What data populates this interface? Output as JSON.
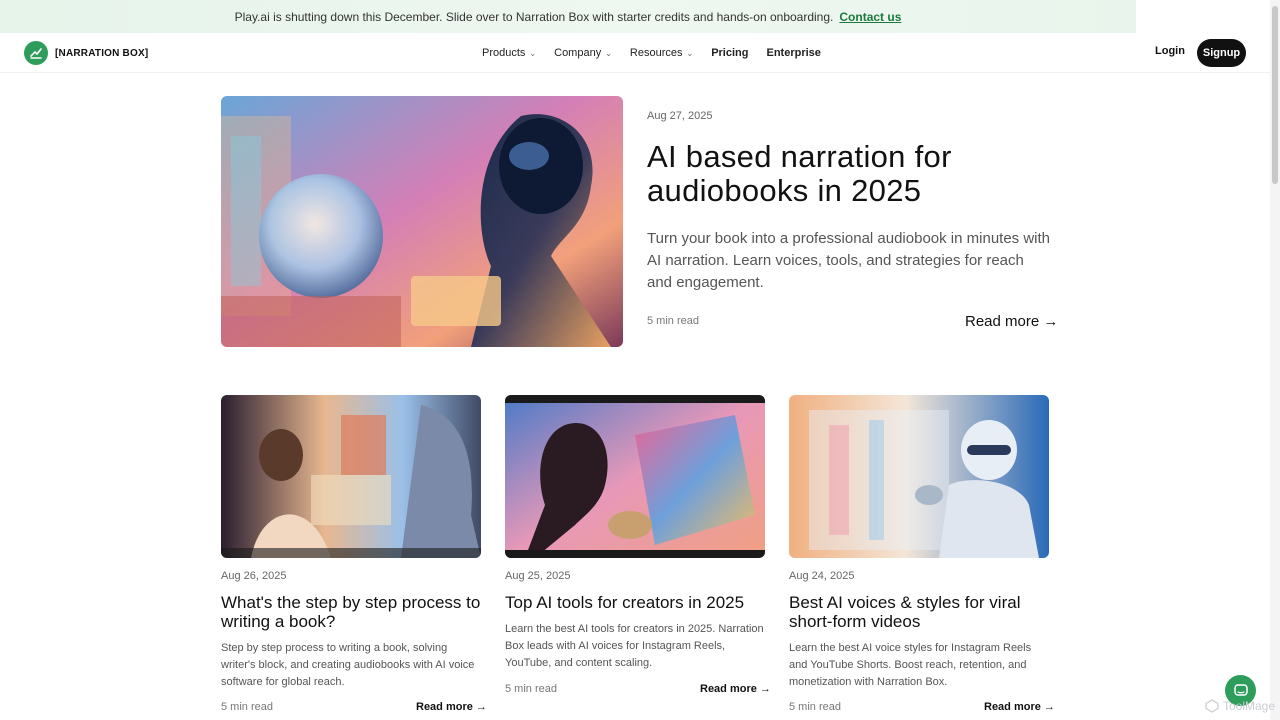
{
  "banner": {
    "message": "Play.ai is shutting down this December. Slide over to Narration Box with starter credits and hands-on onboarding.",
    "link": "Contact us"
  },
  "nav": {
    "logo_text": "[NARRATION BOX]",
    "menu": [
      {
        "label": "Products",
        "has_dropdown": true
      },
      {
        "label": "Company",
        "has_dropdown": true
      },
      {
        "label": "Resources",
        "has_dropdown": true
      },
      {
        "label": "Pricing",
        "has_dropdown": false
      },
      {
        "label": "Enterprise",
        "has_dropdown": false
      }
    ],
    "login": "Login",
    "signup": "Signup"
  },
  "hero": {
    "date": "Aug 27, 2025",
    "title": "AI based narration for audiobooks in 2025",
    "description": "Turn your book into a professional audiobook in minutes with AI narration. Learn voices, tools, and strategies for reach and engagement.",
    "read_time": "5 min read",
    "read_more": "Read more →"
  },
  "cards": [
    {
      "date": "Aug 26, 2025",
      "title": "What's the step by step process to writing a book?",
      "description": "Step by step process to writing a book, solving writer's block, and creating audiobooks with AI voice software for global reach.",
      "read_time": "5 min read",
      "read_more": "Read more →"
    },
    {
      "date": "Aug 25, 2025",
      "title": "Top AI tools for creators in 2025",
      "description": "Learn the best AI tools for creators in 2025. Narration Box leads with AI voices for Instagram Reels, YouTube, and content scaling.",
      "read_time": "5 min read",
      "read_more": "Read more →"
    },
    {
      "date": "Aug 24, 2025",
      "title": "Best AI voices & styles for viral short-form videos",
      "description": "Learn the best AI voice styles for Instagram Reels and YouTube Shorts. Boost reach, retention, and monetization with Narration Box.",
      "read_time": "5 min read",
      "read_more": "Read more →"
    }
  ],
  "watermark": "ToolMage",
  "colors": {
    "brand_green": "#2e9c5b",
    "banner_bg": "#e6f4ea",
    "link_green": "#1b7a3e",
    "signup_bg": "#111111"
  },
  "icons": [
    "logo-mark-icon",
    "chevron-down-icon",
    "chat-bubble-icon",
    "watermark-icon"
  ]
}
